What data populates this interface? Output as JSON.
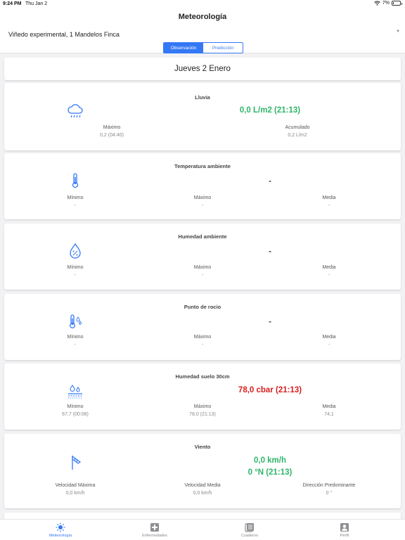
{
  "status_bar": {
    "time": "9:24 PM",
    "date": "Thu Jan 2",
    "battery": "7%",
    "battery_level": 0.07
  },
  "header": {
    "title": "Meteorología",
    "location": "Viñedo experimental, 1 Mandelos Finca",
    "segments": [
      "Observación",
      "Predicción"
    ],
    "active_segment": "Observación"
  },
  "date_label": "Jueves 2 Enero",
  "cards": {
    "lluvia": {
      "title": "Lluvia",
      "icon": "rain-cloud-icon",
      "value": "0,0 L/m2 (21:13)",
      "stats": [
        {
          "label": "Máximo",
          "value": "0,2 (04:40)"
        },
        {
          "label": "Acumulado",
          "value": "0,2 L/m2"
        }
      ]
    },
    "temperatura": {
      "title": "Temperatura ambiente",
      "icon": "thermometer-icon",
      "value": "-",
      "stats": [
        {
          "label": "Mínimo",
          "value": "-"
        },
        {
          "label": "Máximo",
          "value": "-"
        },
        {
          "label": "Media",
          "value": "-"
        }
      ]
    },
    "humedad": {
      "title": "Humedad ambiente",
      "icon": "humidity-drop-icon",
      "value": "-",
      "stats": [
        {
          "label": "Mínimo",
          "value": "-"
        },
        {
          "label": "Máximo",
          "value": "-"
        },
        {
          "label": "Media",
          "value": "-"
        }
      ]
    },
    "rocio": {
      "title": "Punto de rocio",
      "icon": "dew-point-icon",
      "value": "-",
      "stats": [
        {
          "label": "Mínimo",
          "value": "-"
        },
        {
          "label": "Máximo",
          "value": "-"
        },
        {
          "label": "Media",
          "value": "-"
        }
      ]
    },
    "suelo": {
      "title": "Humedad suelo 30cm",
      "icon": "soil-moisture-icon",
      "value": "78,0 cbar (21:13)",
      "stats": [
        {
          "label": "Mínimo",
          "value": "67,7 (00:08)"
        },
        {
          "label": "Máximo",
          "value": "78,0 (21:13)"
        },
        {
          "label": "Media",
          "value": "74,1"
        }
      ]
    },
    "viento": {
      "title": "Viento",
      "icon": "wind-vane-icon",
      "value_speed": "0,0 km/h",
      "value_direction": "0 °N (21:13)",
      "stats": [
        {
          "label": "Velocidad Máxima",
          "value": "0,0 km/h"
        },
        {
          "label": "Velocidad Media",
          "value": "0,0 km/h"
        },
        {
          "label": "Dirección Predominante",
          "value": "0 °"
        }
      ]
    }
  },
  "tabs": [
    {
      "label": "Meteorología",
      "icon": "sun-icon"
    },
    {
      "label": "Enfermedades",
      "icon": "medical-cross-icon"
    },
    {
      "label": "Cuaderno",
      "icon": "notebook-icon"
    },
    {
      "label": "Perfil",
      "icon": "profile-icon"
    }
  ],
  "colors": {
    "accent": "#3478f6",
    "good": "#2fb56a",
    "alert": "#d81e1e",
    "warning": "#f0982a"
  }
}
